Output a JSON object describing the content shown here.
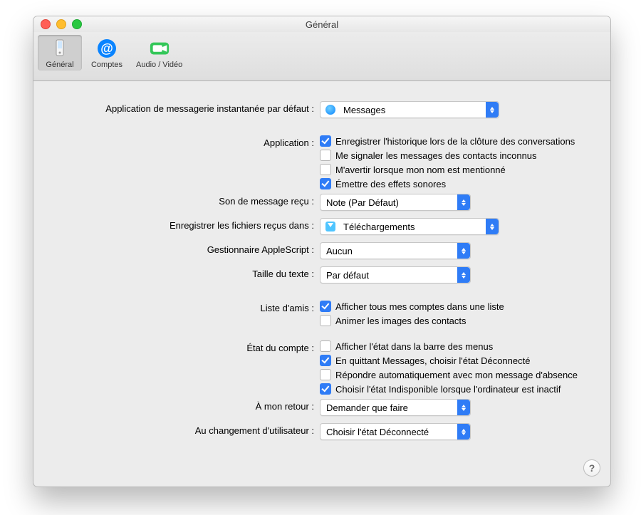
{
  "window": {
    "title": "Général"
  },
  "toolbar": {
    "items": [
      {
        "label": "Général",
        "active": true
      },
      {
        "label": "Comptes",
        "active": false
      },
      {
        "label": "Audio / Vidéo",
        "active": false
      }
    ]
  },
  "labels": {
    "default_app": "Application de messagerie instantanée par défaut :",
    "application": "Application :",
    "received_sound": "Son de message reçu :",
    "save_files": "Enregistrer les fichiers reçus dans :",
    "applescript": "Gestionnaire AppleScript :",
    "text_size": "Taille du texte :",
    "buddy_list": "Liste d'amis :",
    "account_status": "État du compte :",
    "on_return": "À mon retour :",
    "user_switch": "Au changement d'utilisateur :"
  },
  "popups": {
    "default_app": "Messages",
    "received_sound": "Note (Par Défaut)",
    "save_files": "Téléchargements",
    "applescript": "Aucun",
    "text_size": "Par défaut",
    "on_return": "Demander que faire",
    "user_switch": "Choisir l'état Déconnecté"
  },
  "checks": {
    "application": [
      {
        "label": "Enregistrer l'historique lors de la clôture des conversations",
        "checked": true
      },
      {
        "label": "Me signaler les messages des contacts inconnus",
        "checked": false
      },
      {
        "label": "M'avertir lorsque mon nom est mentionné",
        "checked": false
      },
      {
        "label": "Émettre des effets sonores",
        "checked": true
      }
    ],
    "buddy_list": [
      {
        "label": "Afficher tous mes comptes dans une liste",
        "checked": true
      },
      {
        "label": "Animer les images des contacts",
        "checked": false
      }
    ],
    "account_status": [
      {
        "label": "Afficher l'état dans la barre des menus",
        "checked": false
      },
      {
        "label": "En quittant Messages, choisir l'état Déconnecté",
        "checked": true
      },
      {
        "label": "Répondre automatiquement avec mon message d'absence",
        "checked": false
      },
      {
        "label": "Choisir l'état Indisponible lorsque l'ordinateur est inactif",
        "checked": true
      }
    ]
  },
  "help_glyph": "?"
}
